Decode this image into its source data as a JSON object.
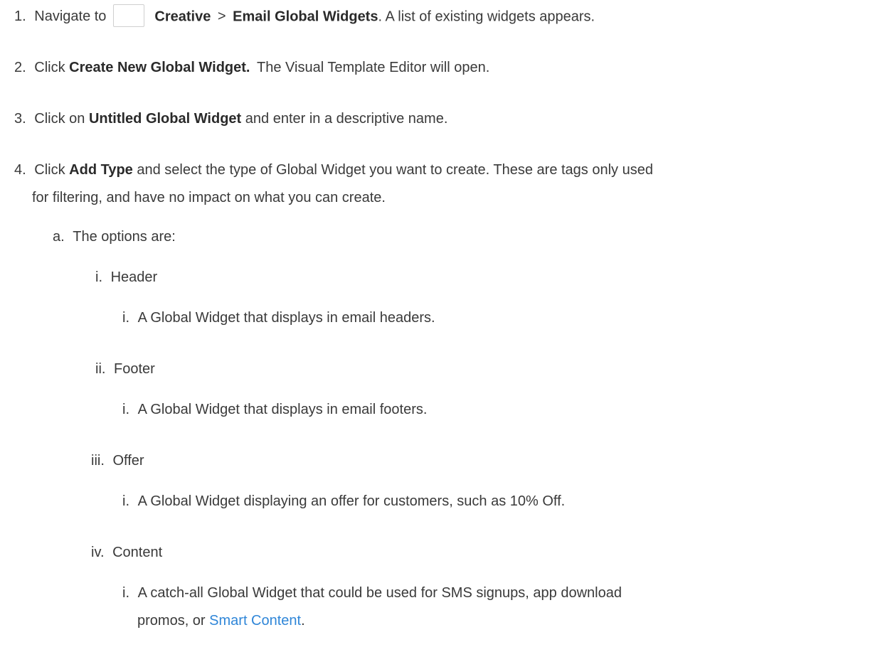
{
  "steps": [
    {
      "num": "1.",
      "pre": "Navigate to",
      "bold1": "Creative",
      "sep": ">",
      "bold2": "Email Global Widgets",
      "post": ". A list of existing widgets appears."
    },
    {
      "num": "2.",
      "pre": "Click",
      "bold": "Create New Global Widget.",
      "post": "The Visual Template Editor will open."
    },
    {
      "num": "3.",
      "pre": "Click on",
      "bold": "Untitled Global Widget",
      "post": "and enter in a descriptive name."
    },
    {
      "num": "4.",
      "pre": "Click",
      "bold": "Add Type",
      "post": "and select the type of Global Widget you want to create. These are tags only used",
      "line2": "for filtering, and have no impact on what you can create."
    }
  ],
  "sub_a": {
    "num": "a.",
    "text": "The options are:"
  },
  "options": [
    {
      "num": "i.",
      "label": "Header",
      "desc_num": "i.",
      "desc": "A Global Widget that displays in email headers."
    },
    {
      "num": "ii.",
      "label": "Footer",
      "desc_num": "i.",
      "desc": "A Global Widget that displays in email footers."
    },
    {
      "num": "iii.",
      "label": "Offer",
      "desc_num": "i.",
      "desc": "A Global Widget displaying an offer for customers, such as 10% Off."
    },
    {
      "num": "iv.",
      "label": "Content",
      "desc_num": "i.",
      "desc": "A catch-all Global Widget that could be used for SMS signups, app download",
      "desc_line2": "promos, or",
      "link": "Smart Content",
      "desc_end": "."
    }
  ]
}
